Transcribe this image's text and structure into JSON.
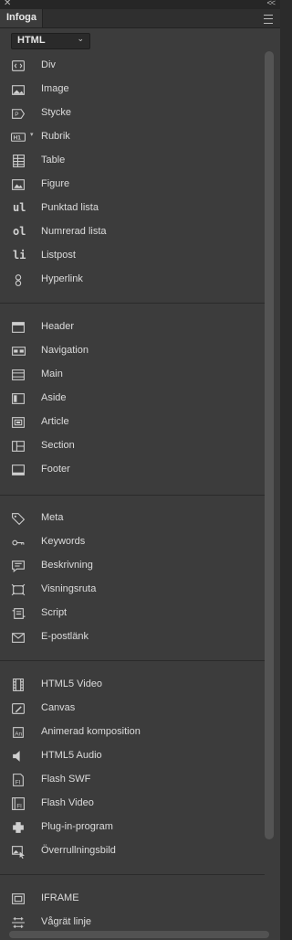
{
  "window": {
    "close_glyph": "✕",
    "collapse_glyph": "<<"
  },
  "panel": {
    "tab_label": "Infoga",
    "menu_icon": "panel-menu-icon"
  },
  "category": {
    "selected": "HTML"
  },
  "items": [
    {
      "label": "Div",
      "icon": "div-icon"
    },
    {
      "label": "Image",
      "icon": "image-icon"
    },
    {
      "label": "Stycke",
      "icon": "paragraph-icon"
    },
    {
      "label": "Rubrik",
      "icon": "heading-icon",
      "has_dropdown": true
    },
    {
      "label": "Table",
      "icon": "table-icon"
    },
    {
      "label": "Figure",
      "icon": "figure-icon"
    },
    {
      "label": "Punktad lista",
      "icon": "unordered-list-icon",
      "glyph": "ul"
    },
    {
      "label": "Numrerad lista",
      "icon": "ordered-list-icon",
      "glyph": "ol"
    },
    {
      "label": "Listpost",
      "icon": "list-item-icon",
      "glyph": "li"
    },
    {
      "label": "Hyperlink",
      "icon": "hyperlink-icon"
    },
    {
      "label": "Header",
      "icon": "header-icon"
    },
    {
      "label": "Navigation",
      "icon": "navigation-icon"
    },
    {
      "label": "Main",
      "icon": "main-icon"
    },
    {
      "label": "Aside",
      "icon": "aside-icon"
    },
    {
      "label": "Article",
      "icon": "article-icon"
    },
    {
      "label": "Section",
      "icon": "section-icon"
    },
    {
      "label": "Footer",
      "icon": "footer-icon"
    },
    {
      "label": "Meta",
      "icon": "meta-tag-icon"
    },
    {
      "label": "Keywords",
      "icon": "key-icon"
    },
    {
      "label": "Beskrivning",
      "icon": "description-icon"
    },
    {
      "label": "Visningsruta",
      "icon": "viewport-icon"
    },
    {
      "label": "Script",
      "icon": "script-icon"
    },
    {
      "label": "E-postlänk",
      "icon": "email-icon"
    },
    {
      "label": "HTML5 Video",
      "icon": "video-icon"
    },
    {
      "label": "Canvas",
      "icon": "canvas-icon"
    },
    {
      "label": "Animerad komposition",
      "icon": "animated-composition-icon"
    },
    {
      "label": "HTML5 Audio",
      "icon": "audio-icon"
    },
    {
      "label": "Flash SWF",
      "icon": "flash-swf-icon"
    },
    {
      "label": "Flash Video",
      "icon": "flash-video-icon"
    },
    {
      "label": "Plug-in-program",
      "icon": "plugin-icon"
    },
    {
      "label": "Överrullningsbild",
      "icon": "rollover-image-icon"
    },
    {
      "label": "IFRAME",
      "icon": "iframe-icon"
    },
    {
      "label": "Vågrät linje",
      "icon": "horizontal-rule-icon"
    }
  ],
  "colors": {
    "panel_bg": "#3c3c3c",
    "text": "#dcdcdc",
    "separator": "#2a2a2a"
  }
}
